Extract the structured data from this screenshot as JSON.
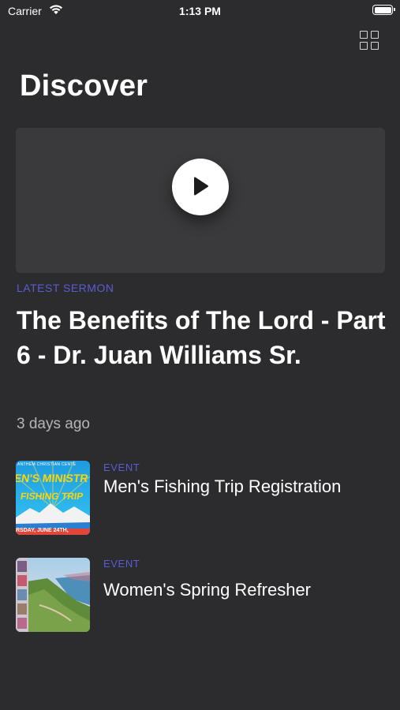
{
  "status_bar": {
    "carrier": "Carrier",
    "time": "1:13 PM"
  },
  "header": {
    "title": "Discover"
  },
  "featured": {
    "label": "LATEST SERMON",
    "title": "The Benefits of The Lord - Part 6 - Dr. Juan Williams Sr.",
    "time_ago": "3 days ago"
  },
  "events": [
    {
      "tag": "EVENT",
      "title": "Men's Fishing Trip Registration",
      "thumb_text_top": "EN'S MINISTR",
      "thumb_text_main": "FISHING TRIP",
      "thumb_text_bottom": "RSDAY, JUNE 24TH,",
      "thumb_text_header": "ANTHEM CHRISTIAN CENTE"
    },
    {
      "tag": "EVENT",
      "title": "Women's Spring Refresher"
    }
  ],
  "colors": {
    "background": "#2c2c2e",
    "accent": "#5b5bd6",
    "card": "#3a3a3c"
  },
  "icons": {
    "grid": "grid-view-icon",
    "play": "play-icon",
    "wifi": "wifi-icon",
    "battery": "battery-icon"
  }
}
